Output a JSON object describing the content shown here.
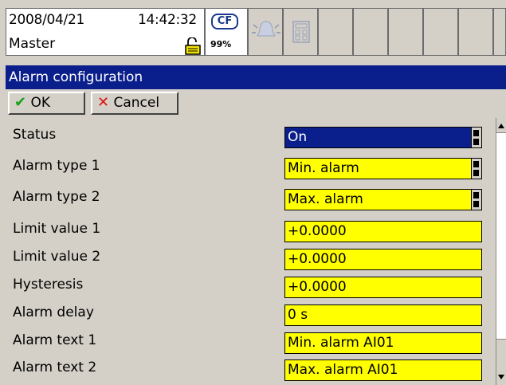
{
  "status": {
    "date": "2008/04/21",
    "time": "14:42:32",
    "user": "Master"
  },
  "storage": {
    "badge": "CF",
    "percent": "99%"
  },
  "window": {
    "title": "Alarm configuration"
  },
  "toolbar": {
    "ok_label": "OK",
    "cancel_label": "Cancel"
  },
  "form": {
    "rows": [
      {
        "label": "Status",
        "value": "On",
        "dropdown": true,
        "selected": true
      },
      {
        "label": "Alarm type 1",
        "value": "Min. alarm",
        "dropdown": true
      },
      {
        "label": "Alarm type 2",
        "value": "Max. alarm",
        "dropdown": true
      },
      {
        "label": "Limit value 1",
        "value": "+0.0000"
      },
      {
        "label": "Limit value 2",
        "value": "+0.0000"
      },
      {
        "label": "Hysteresis",
        "value": "+0.0000"
      },
      {
        "label": "Alarm delay",
        "value": "0 s"
      },
      {
        "label": "Alarm text 1",
        "value": "Min. alarm AI01"
      },
      {
        "label": "Alarm text 2",
        "value": "Max. alarm AI01"
      }
    ]
  },
  "icons": {
    "lock": "open-lock-icon",
    "alarm": "alarm-bell-icon",
    "calculator": "calculator-icon"
  },
  "colors": {
    "title_bg": "#0a1e8c",
    "field_bg": "#ffff00",
    "panel_bg": "#d4d0c8"
  }
}
